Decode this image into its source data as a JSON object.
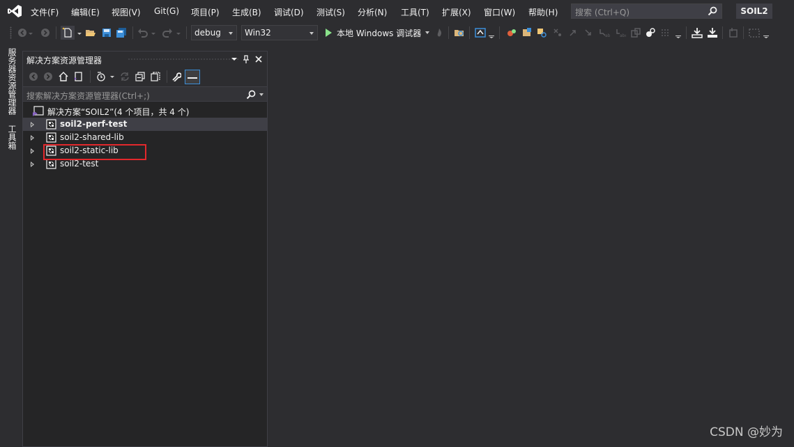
{
  "menubar": {
    "items": [
      "文件(F)",
      "编辑(E)",
      "视图(V)",
      "Git(G)",
      "项目(P)",
      "生成(B)",
      "调试(D)",
      "测试(S)",
      "分析(N)",
      "工具(T)",
      "扩展(X)",
      "窗口(W)",
      "帮助(H)"
    ],
    "search_placeholder": "搜索 (Ctrl+Q)",
    "solution_name": "SOIL2"
  },
  "toolbar": {
    "configuration": "debug",
    "platform": "Win32",
    "run_label": "本地 Windows 调试器"
  },
  "left_tabs": [
    "服务器资源管理器",
    "工具箱"
  ],
  "solution_explorer": {
    "title": "解决方案资源管理器",
    "search_placeholder": "搜索解决方案资源管理器(Ctrl+;)",
    "solution_label": "解决方案“SOIL2”(4 个项目，共 4 个)",
    "projects": [
      {
        "name": "soil2-perf-test",
        "bold": true,
        "selected": true
      },
      {
        "name": "soil2-shared-lib",
        "bold": false,
        "selected": false
      },
      {
        "name": "soil2-static-lib",
        "bold": false,
        "selected": false,
        "highlighted": true
      },
      {
        "name": "soil2-test",
        "bold": false,
        "selected": false
      }
    ]
  },
  "watermark": "CSDN @妙为",
  "colors": {
    "background": "#2d2d30",
    "panel": "#252526",
    "highlight_box": "#e3282c",
    "vs_purple": "#865fc5",
    "run_green": "#8ae28a"
  }
}
